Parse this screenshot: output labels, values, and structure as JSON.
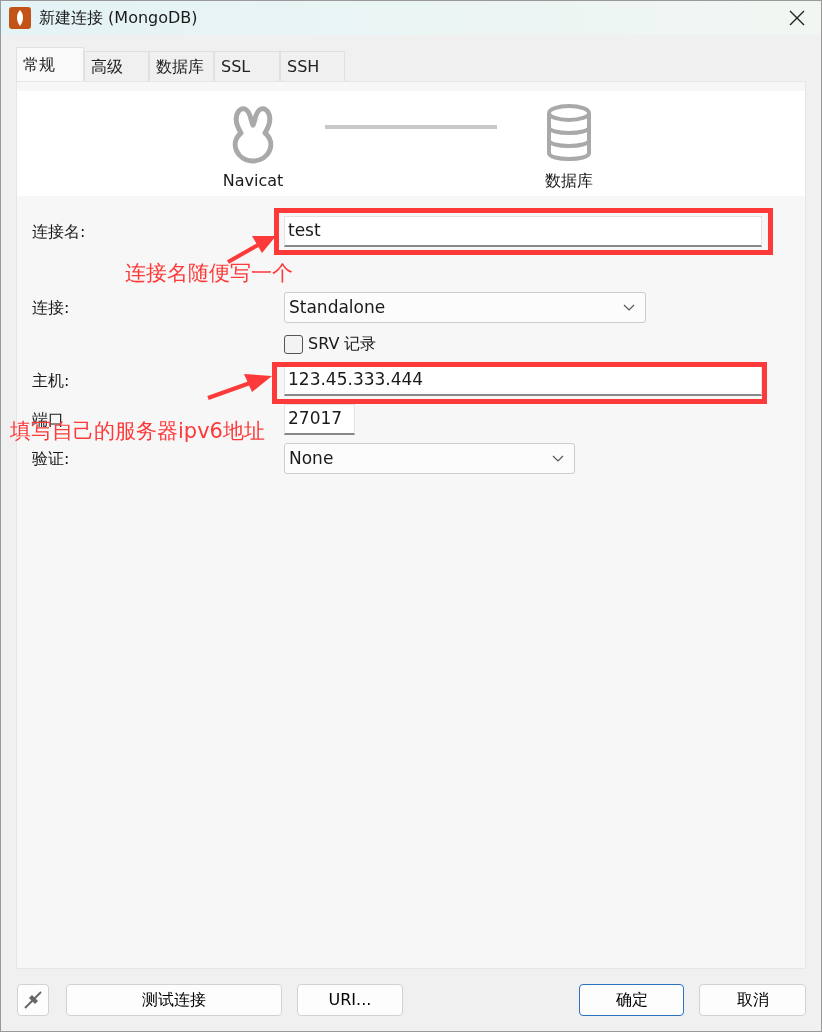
{
  "window": {
    "title": "新建连接 (MongoDB)"
  },
  "tabs": [
    {
      "label": "常规",
      "selected": true
    },
    {
      "label": "高级",
      "selected": false
    },
    {
      "label": "数据库",
      "selected": false
    },
    {
      "label": "SSL",
      "selected": false
    },
    {
      "label": "SSH",
      "selected": false
    }
  ],
  "header": {
    "left_label": "Navicat",
    "right_label": "数据库"
  },
  "form": [
    {
      "kind": "text",
      "label": "连接名:",
      "value": "test"
    },
    {
      "kind": "select",
      "label": "连接:",
      "value": "Standalone"
    },
    {
      "kind": "checkbox",
      "label": "SRV 记录",
      "checked": false
    },
    {
      "kind": "text",
      "label": "主机:",
      "value": "123.45.333.444"
    },
    {
      "kind": "text",
      "label": "端口",
      "value": "27017"
    },
    {
      "kind": "select",
      "label": "验证:",
      "value": "None"
    }
  ],
  "annotations": [
    {
      "text": "连接名随便写一个"
    },
    {
      "text": "填写自己的服务器ipv6地址"
    }
  ],
  "buttons": [
    {
      "label": "测试连接",
      "default": false
    },
    {
      "label": "URI...",
      "default": false
    },
    {
      "label": "确定",
      "default": true
    },
    {
      "label": "取消",
      "default": false
    }
  ]
}
